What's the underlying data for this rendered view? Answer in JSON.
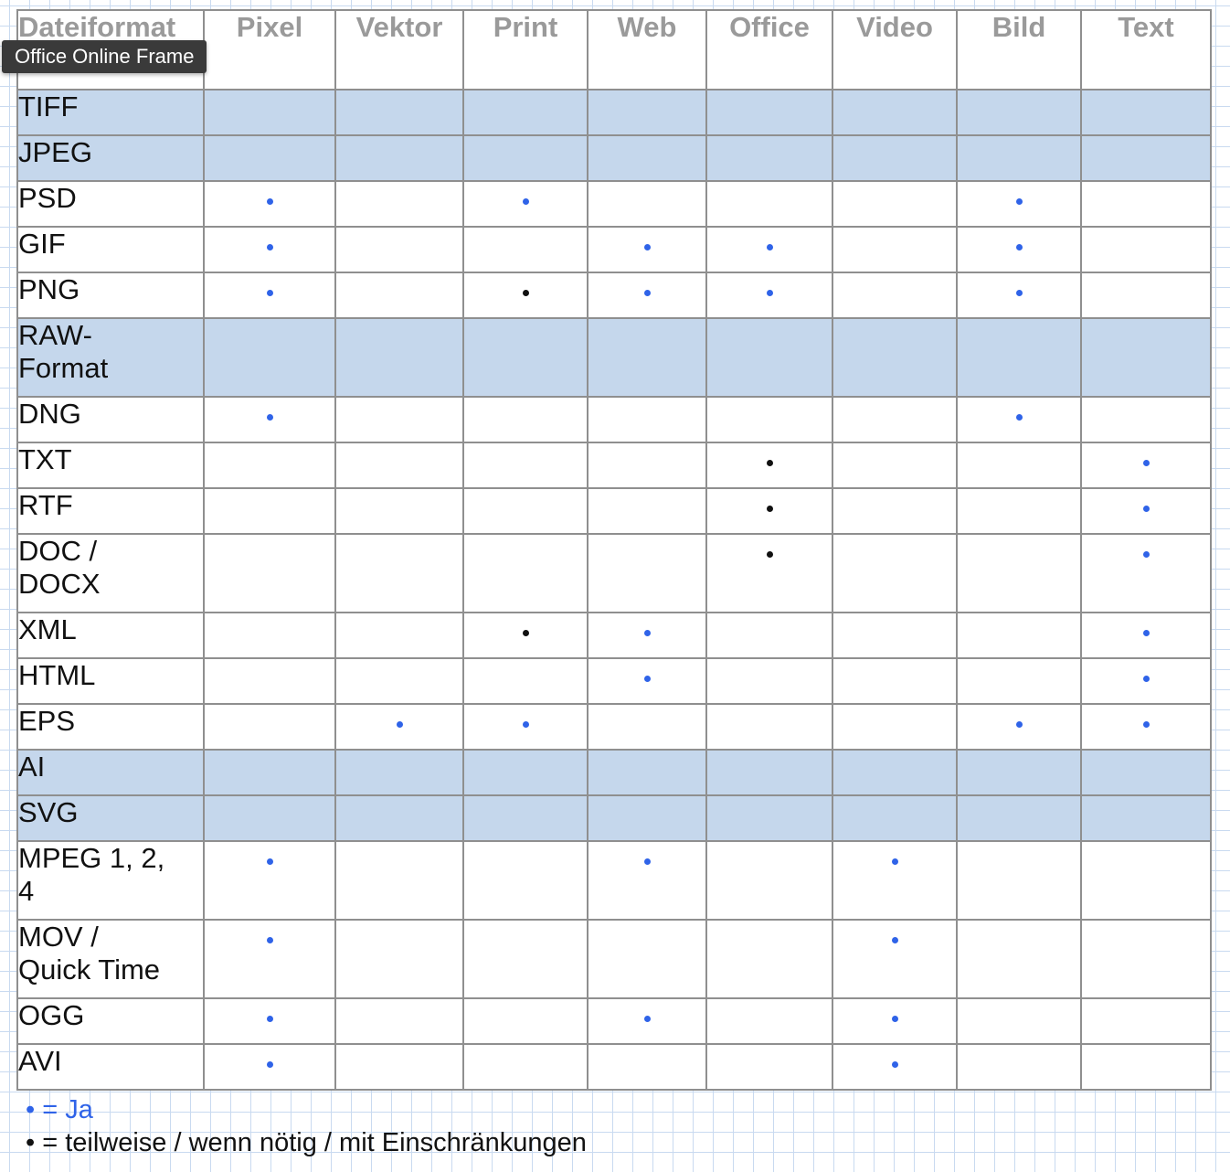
{
  "tooltip": "Office Online Frame",
  "header": [
    "Dateiformat",
    "Pixel",
    "Vektor",
    "Print",
    "Web",
    "Office",
    "Video",
    "Bild",
    "Text"
  ],
  "rows": [
    {
      "label": "TIFF",
      "highlight": true,
      "marks": [
        "",
        "",
        "",
        "",
        "",
        "",
        "",
        ""
      ]
    },
    {
      "label": "JPEG",
      "highlight": true,
      "marks": [
        "",
        "",
        "",
        "",
        "",
        "",
        "",
        ""
      ]
    },
    {
      "label": "PSD",
      "marks": [
        "yes",
        "",
        "yes",
        "",
        "",
        "",
        "yes",
        ""
      ]
    },
    {
      "label": "GIF",
      "marks": [
        "yes",
        "",
        "",
        "yes",
        "yes",
        "",
        "yes",
        ""
      ]
    },
    {
      "label": "PNG",
      "marks": [
        "yes",
        "",
        "partial",
        "yes",
        "yes",
        "",
        "yes",
        ""
      ]
    },
    {
      "label": "RAW-\nFormat",
      "highlight": true,
      "tall": true,
      "marks": [
        "",
        "",
        "",
        "",
        "",
        "",
        "",
        ""
      ]
    },
    {
      "label": "DNG",
      "marks": [
        "yes",
        "",
        "",
        "",
        "",
        "",
        "yes",
        ""
      ]
    },
    {
      "label": "TXT",
      "marks": [
        "",
        "",
        "",
        "",
        "partial",
        "",
        "",
        "yes"
      ]
    },
    {
      "label": "RTF",
      "marks": [
        "",
        "",
        "",
        "",
        "partial",
        "",
        "",
        "yes"
      ]
    },
    {
      "label": "DOC /\nDOCX",
      "tall": true,
      "marks": [
        "",
        "",
        "",
        "",
        "partial",
        "",
        "",
        "yes"
      ]
    },
    {
      "label": "XML",
      "marks": [
        "",
        "",
        "partial",
        "yes",
        "",
        "",
        "",
        "yes"
      ]
    },
    {
      "label": "HTML",
      "marks": [
        "",
        "",
        "",
        "yes",
        "",
        "",
        "",
        "yes"
      ]
    },
    {
      "label": "EPS",
      "marks": [
        "",
        "yes",
        "yes",
        "",
        "",
        "",
        "yes",
        "yes"
      ]
    },
    {
      "label": "AI",
      "highlight": true,
      "marks": [
        "",
        "",
        "",
        "",
        "",
        "",
        "",
        ""
      ]
    },
    {
      "label": "SVG",
      "highlight": true,
      "marks": [
        "",
        "",
        "",
        "",
        "",
        "",
        "",
        ""
      ]
    },
    {
      "label": "MPEG 1, 2,\n4",
      "tall": true,
      "marks": [
        "yes",
        "",
        "",
        "yes",
        "",
        "yes",
        "",
        ""
      ]
    },
    {
      "label": "MOV /\nQuick Time",
      "tall": true,
      "marks": [
        "yes",
        "",
        "",
        "",
        "",
        "yes",
        "",
        ""
      ]
    },
    {
      "label": "OGG",
      "marks": [
        "yes",
        "",
        "",
        "yes",
        "",
        "yes",
        "",
        ""
      ]
    },
    {
      "label": "AVI",
      "marks": [
        "yes",
        "",
        "",
        "",
        "",
        "yes",
        "",
        ""
      ]
    }
  ],
  "legend": {
    "yes_symbol": "•",
    "yes_text": "= Ja",
    "partial_symbol": "•",
    "partial_text": "= teilweise / wenn nötig / mit Einschränkungen"
  },
  "colors": {
    "yes": "#2f63e8",
    "partial": "#111111",
    "highlight_row": "#c5d7ec",
    "grid": "#c9daf0"
  }
}
